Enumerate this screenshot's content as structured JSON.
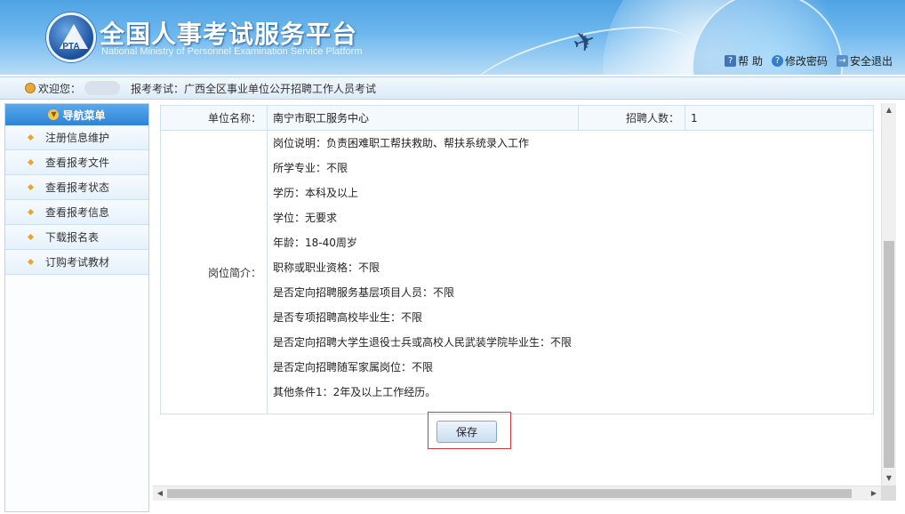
{
  "header": {
    "title": "全国人事考试服务平台",
    "subtitle": "National Ministry of Personnel Examination Service Platform",
    "logo_text": "PTA",
    "links": [
      {
        "label": "帮 助",
        "icon": "help-icon"
      },
      {
        "label": "修改密码",
        "icon": "key-icon"
      },
      {
        "label": "安全退出",
        "icon": "exit-icon"
      }
    ]
  },
  "welcome": {
    "greeting": "欢迎您：",
    "exam_label": "报考考试：广西全区事业单位公开招聘工作人员考试"
  },
  "sidebar": {
    "header": "导航菜单",
    "items": [
      {
        "label": "注册信息维护"
      },
      {
        "label": "查看报考文件"
      },
      {
        "label": "查看报考状态"
      },
      {
        "label": "查看报考信息"
      },
      {
        "label": "下载报名表"
      },
      {
        "label": "订购考试教材"
      }
    ]
  },
  "job": {
    "unit_label": "单位名称：",
    "unit_value": "南宁市职工服务中心",
    "hires_label": "招聘人数：",
    "hires_value": "1",
    "desc_label": "岗位简介：",
    "desc_lines": [
      "岗位说明：负责困难职工帮扶救助、帮扶系统录入工作",
      "所学专业：不限",
      "学历：本科及以上",
      "学位：无要求",
      "年龄：18-40周岁",
      "职称或职业资格：不限",
      "是否定向招聘服务基层项目人员：不限",
      "是否专项招聘高校毕业生：不限",
      "是否定向招聘大学生退役士兵或高校人民武装学院毕业生：不限",
      "是否定向招聘随军家属岗位：不限",
      "其他条件1：2年及以上工作经历。"
    ]
  },
  "actions": {
    "save_label": "保存"
  },
  "colors": {
    "header_blue": "#4fa3e3",
    "nav_head": "#2d83d6",
    "highlight_border": "#d23a3a"
  }
}
